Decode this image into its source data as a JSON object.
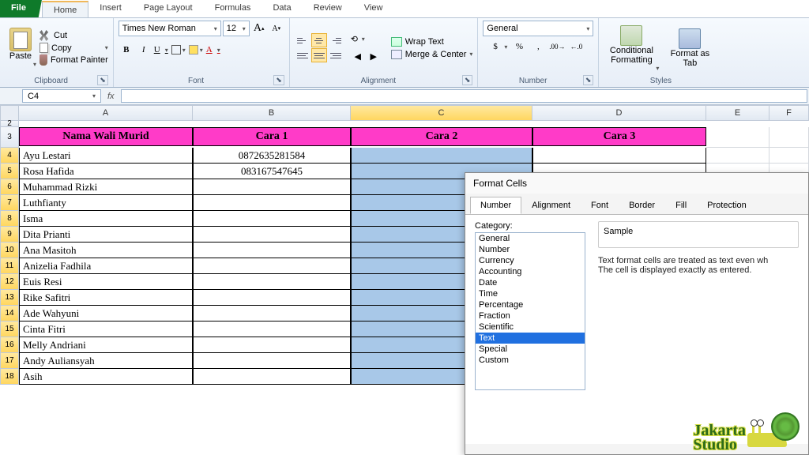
{
  "tabs": {
    "file": "File",
    "home": "Home",
    "insert": "Insert",
    "pagelayout": "Page Layout",
    "formulas": "Formulas",
    "data": "Data",
    "review": "Review",
    "view": "View"
  },
  "clipboard": {
    "paste": "Paste",
    "cut": "Cut",
    "copy": "Copy",
    "painter": "Format Painter",
    "label": "Clipboard"
  },
  "font": {
    "name": "Times New Roman",
    "size": "12",
    "label": "Font",
    "bold": "B",
    "italic": "I",
    "underline": "U",
    "grow": "A",
    "shrink": "A",
    "color": "A"
  },
  "alignment": {
    "wrap": "Wrap Text",
    "merge": "Merge & Center",
    "label": "Alignment"
  },
  "number": {
    "format": "General",
    "label": "Number"
  },
  "styles": {
    "cond": "Conditional Formatting",
    "table": "Format as Tab",
    "label": "Styles"
  },
  "namebox": "C4",
  "fx": "fx",
  "cols": {
    "A": "A",
    "B": "B",
    "C": "C",
    "D": "D",
    "E": "E",
    "F": "F"
  },
  "headers": {
    "name": "Nama Wali Murid",
    "c1": "Cara 1",
    "c2": "Cara 2",
    "c3": "Cara 3"
  },
  "rows": [
    {
      "n": "4",
      "name": "Ayu Lestari",
      "c1": "0872635281584"
    },
    {
      "n": "5",
      "name": "Rosa Hafida",
      "c1": "083167547645"
    },
    {
      "n": "6",
      "name": "Muhammad Rizki",
      "c1": ""
    },
    {
      "n": "7",
      "name": "Luthfianty",
      "c1": ""
    },
    {
      "n": "8",
      "name": "Isma",
      "c1": ""
    },
    {
      "n": "9",
      "name": "Dita Prianti",
      "c1": ""
    },
    {
      "n": "10",
      "name": "Ana Masitoh",
      "c1": ""
    },
    {
      "n": "11",
      "name": "Anizelia Fadhila",
      "c1": ""
    },
    {
      "n": "12",
      "name": "Euis Resi",
      "c1": ""
    },
    {
      "n": "13",
      "name": "Rike Safitri",
      "c1": ""
    },
    {
      "n": "14",
      "name": "Ade Wahyuni",
      "c1": ""
    },
    {
      "n": "15",
      "name": "Cinta Fitri",
      "c1": ""
    },
    {
      "n": "16",
      "name": "Melly Andriani",
      "c1": ""
    },
    {
      "n": "17",
      "name": "Andy Auliansyah",
      "c1": ""
    },
    {
      "n": "18",
      "name": "Asih",
      "c1": ""
    }
  ],
  "dialog": {
    "title": "Format Cells",
    "tabs": {
      "number": "Number",
      "alignment": "Alignment",
      "font": "Font",
      "border": "Border",
      "fill": "Fill",
      "protection": "Protection"
    },
    "category_label": "Category:",
    "categories": [
      "General",
      "Number",
      "Currency",
      "Accounting",
      "Date",
      "Time",
      "Percentage",
      "Fraction",
      "Scientific",
      "Text",
      "Special",
      "Custom"
    ],
    "selected_category": "Text",
    "sample_label": "Sample",
    "desc1": "Text format cells are treated as text even wh",
    "desc2": "The cell is displayed exactly as entered."
  },
  "logo": {
    "l1": "Jakarta",
    "l2": "Studio"
  }
}
